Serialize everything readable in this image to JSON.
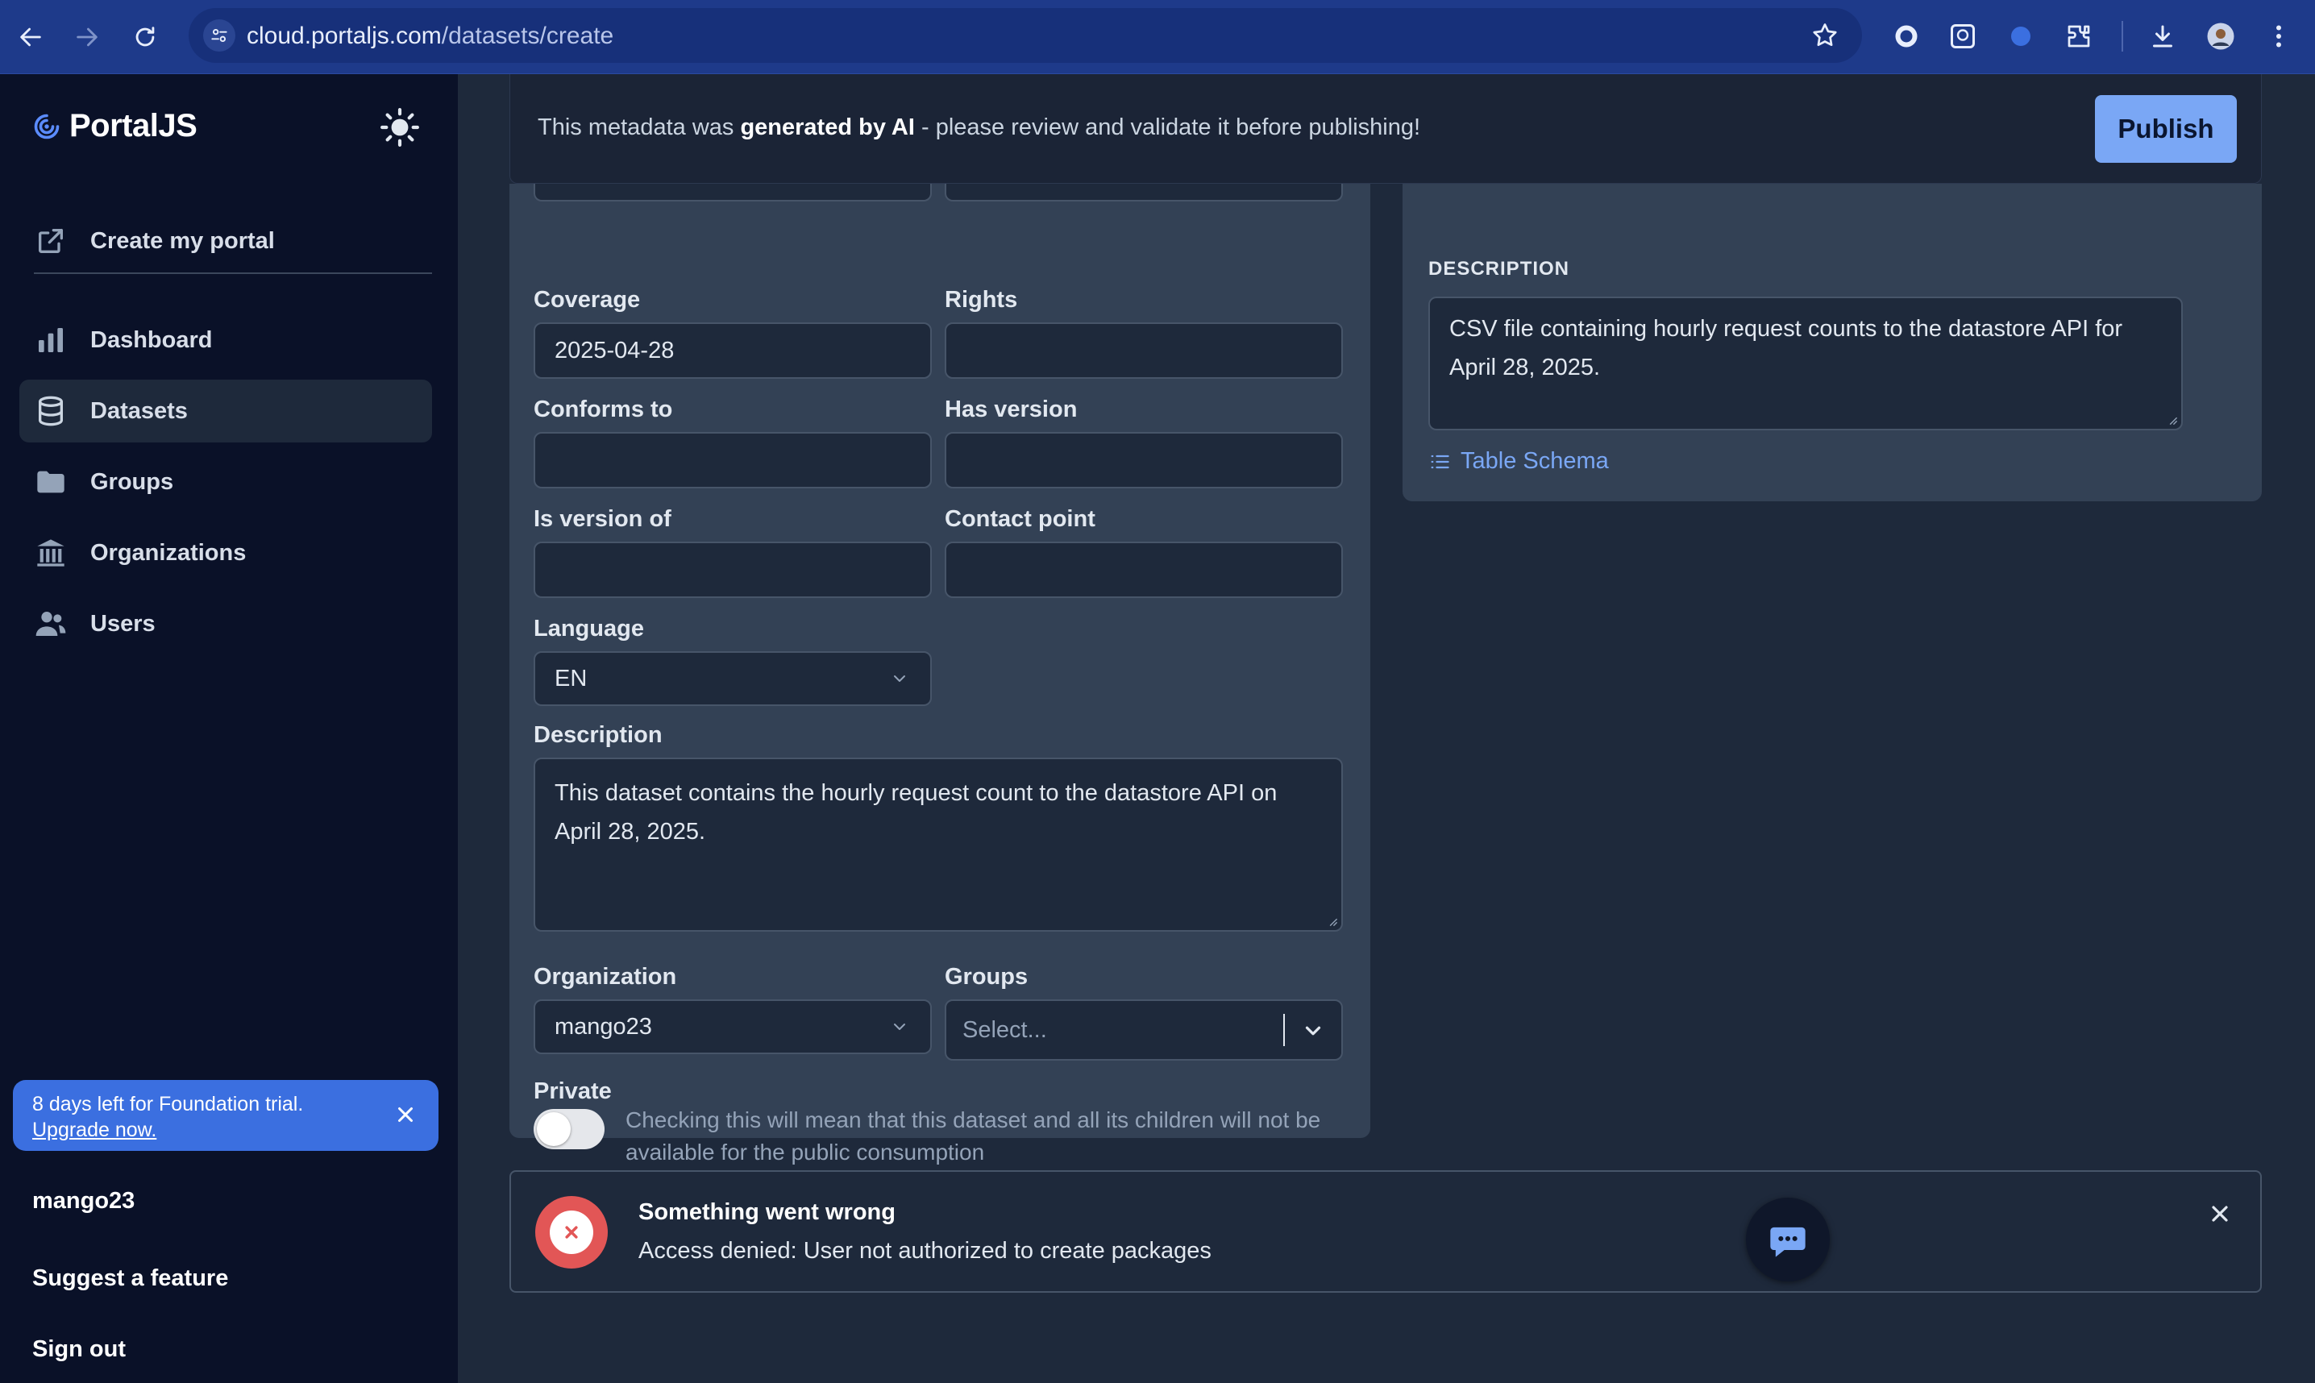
{
  "browser": {
    "url_host": "cloud.portaljs.com",
    "url_path": "/datasets/create"
  },
  "sidebar": {
    "brand": "PortalJS",
    "create_portal": "Create my portal",
    "items": [
      {
        "label": "Dashboard",
        "icon": "bar-chart-icon"
      },
      {
        "label": "Datasets",
        "icon": "database-icon",
        "active": true
      },
      {
        "label": "Groups",
        "icon": "folder-icon"
      },
      {
        "label": "Organizations",
        "icon": "building-icon"
      },
      {
        "label": "Users",
        "icon": "users-icon"
      }
    ],
    "trial": {
      "line1": "8 days left for Foundation trial.",
      "link": "Upgrade now."
    },
    "org": "mango23",
    "suggest": "Suggest a feature",
    "signout": "Sign out"
  },
  "banner": {
    "prefix": "This metadata was ",
    "bold": "generated by AI",
    "suffix": " - please review and validate it before publishing!",
    "publish": "Publish"
  },
  "form": {
    "coverage": {
      "label": "Coverage",
      "value": "2025-04-28"
    },
    "rights": {
      "label": "Rights",
      "value": ""
    },
    "conforms_to": {
      "label": "Conforms to",
      "value": ""
    },
    "has_version": {
      "label": "Has version",
      "value": ""
    },
    "is_version_of": {
      "label": "Is version of",
      "value": ""
    },
    "contact_point": {
      "label": "Contact point",
      "value": ""
    },
    "language": {
      "label": "Language",
      "value": "EN"
    },
    "description": {
      "label": "Description",
      "value": "This dataset contains the hourly request count to the datastore API on April 28, 2025."
    },
    "organization": {
      "label": "Organization",
      "value": "mango23"
    },
    "groups": {
      "label": "Groups",
      "placeholder": "Select..."
    },
    "private": {
      "label": "Private",
      "help": "Checking this will mean that this dataset and all its children will not be available for the public consumption",
      "checked": false
    }
  },
  "resource": {
    "title": "DESCRIPTION",
    "description": "CSV file containing hourly request counts to the datastore API for April 28, 2025.",
    "schema_link": "Table Schema"
  },
  "error": {
    "title": "Something went wrong",
    "message": "Access denied: User not authorized to create packages"
  },
  "colors": {
    "accent": "#7aa7f5",
    "trial_bg": "#3b6fe0",
    "error": "#e25656"
  }
}
